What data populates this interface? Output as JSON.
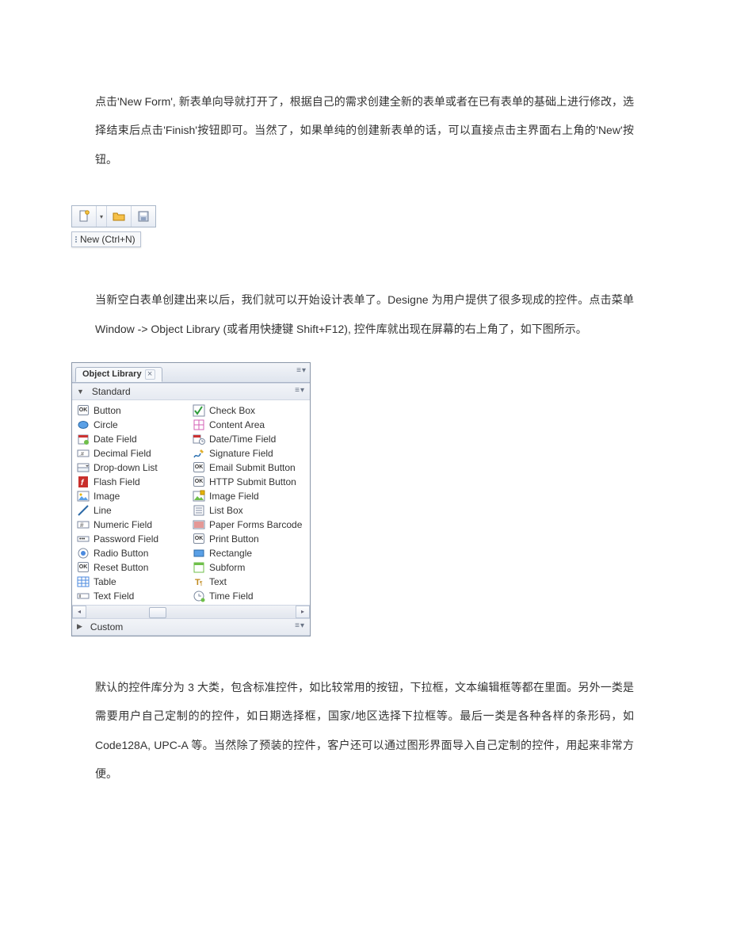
{
  "paragraphs": {
    "p1": "点击'New Form', 新表单向导就打开了，根据自己的需求创建全新的表单或者在已有表单的基础上进行修改，选择结束后点击'Finish'按钮即可。当然了，如果单纯的创建新表单的话，可以直接点击主界面右上角的'New'按钮。",
    "p2": "当新空白表单创建出来以后，我们就可以开始设计表单了。Designe 为用户提供了很多现成的控件。点击菜单 Window -> Object Library (或者用快捷键 Shift+F12), 控件库就出现在屏幕的右上角了，如下图所示。",
    "p3": "默认的控件库分为 3 大类，包含标准控件，如比较常用的按钮，下拉框，文本编辑框等都在里面。另外一类是需要用户自己定制的的控件，如日期选择框，国家/地区选择下拉框等。最后一类是各种各样的条形码，如 Code128A, UPC-A 等。当然除了预装的控件，客户还可以通过图形界面导入自己定制的控件，用起来非常方便。"
  },
  "toolbar": {
    "tooltip": "New (Ctrl+N)"
  },
  "panel": {
    "tabLabel": "Object Library",
    "sectionStandard": "Standard",
    "sectionCustom": "Custom",
    "items": [
      {
        "label": "Button",
        "icon": "ok"
      },
      {
        "label": "Check Box",
        "icon": "check"
      },
      {
        "label": "Circle",
        "icon": "circle"
      },
      {
        "label": "Content Area",
        "icon": "content"
      },
      {
        "label": "Date Field",
        "icon": "date"
      },
      {
        "label": "Date/Time Field",
        "icon": "datetime"
      },
      {
        "label": "Decimal Field",
        "icon": "decimal"
      },
      {
        "label": "Signature Field",
        "icon": "sign"
      },
      {
        "label": "Drop-down List",
        "icon": "dropdown"
      },
      {
        "label": "Email Submit Button",
        "icon": "ok"
      },
      {
        "label": "Flash Field",
        "icon": "flash"
      },
      {
        "label": "HTTP Submit Button",
        "icon": "ok"
      },
      {
        "label": "Image",
        "icon": "image"
      },
      {
        "label": "Image Field",
        "icon": "imagef"
      },
      {
        "label": "Line",
        "icon": "line"
      },
      {
        "label": "List Box",
        "icon": "listbox"
      },
      {
        "label": "Numeric Field",
        "icon": "hash"
      },
      {
        "label": "Paper Forms Barcode",
        "icon": "barcode"
      },
      {
        "label": "Password Field",
        "icon": "password"
      },
      {
        "label": "Print Button",
        "icon": "ok"
      },
      {
        "label": "Radio Button",
        "icon": "radio"
      },
      {
        "label": "Rectangle",
        "icon": "rect"
      },
      {
        "label": "Reset Button",
        "icon": "ok"
      },
      {
        "label": "Subform",
        "icon": "subform"
      },
      {
        "label": "Table",
        "icon": "table"
      },
      {
        "label": "Text",
        "icon": "text"
      },
      {
        "label": "Text Field",
        "icon": "textfield"
      },
      {
        "label": "Time Field",
        "icon": "time"
      }
    ]
  }
}
